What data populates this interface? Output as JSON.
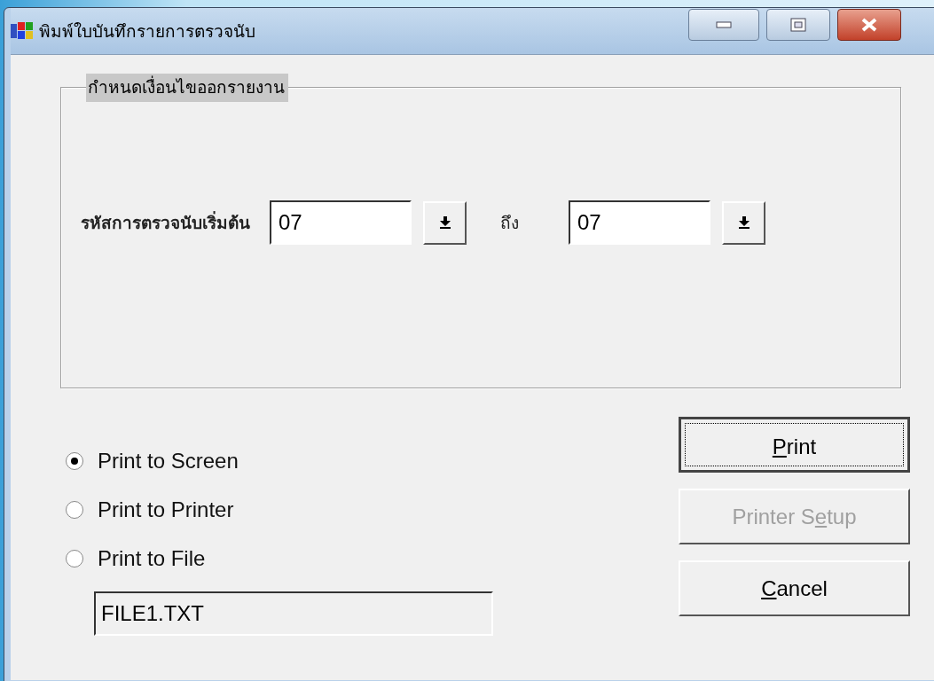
{
  "window": {
    "title": "พิมพ์ใบบันทึกรายการตรวจนับ"
  },
  "group": {
    "legend": "กำหนดเงื่อนไขออกรายงาน",
    "range": {
      "label": "รหัสการตรวจนับเริ่มต้น",
      "from": "07",
      "to_label": "ถึง",
      "to": "07"
    }
  },
  "output_options": [
    {
      "label": "Print to Screen",
      "selected": true
    },
    {
      "label": "Print to Printer",
      "selected": false
    },
    {
      "label": "Print to File",
      "selected": false
    }
  ],
  "file_field": {
    "value": "FILE1.TXT",
    "disabled": true
  },
  "buttons": [
    {
      "key": "P",
      "after": "rint",
      "disabled": false,
      "focused": true
    },
    {
      "before": "Printer S",
      "key": "e",
      "after": "tup",
      "disabled": true,
      "focused": false
    },
    {
      "key": "C",
      "after": "ancel",
      "disabled": false,
      "focused": false
    }
  ]
}
